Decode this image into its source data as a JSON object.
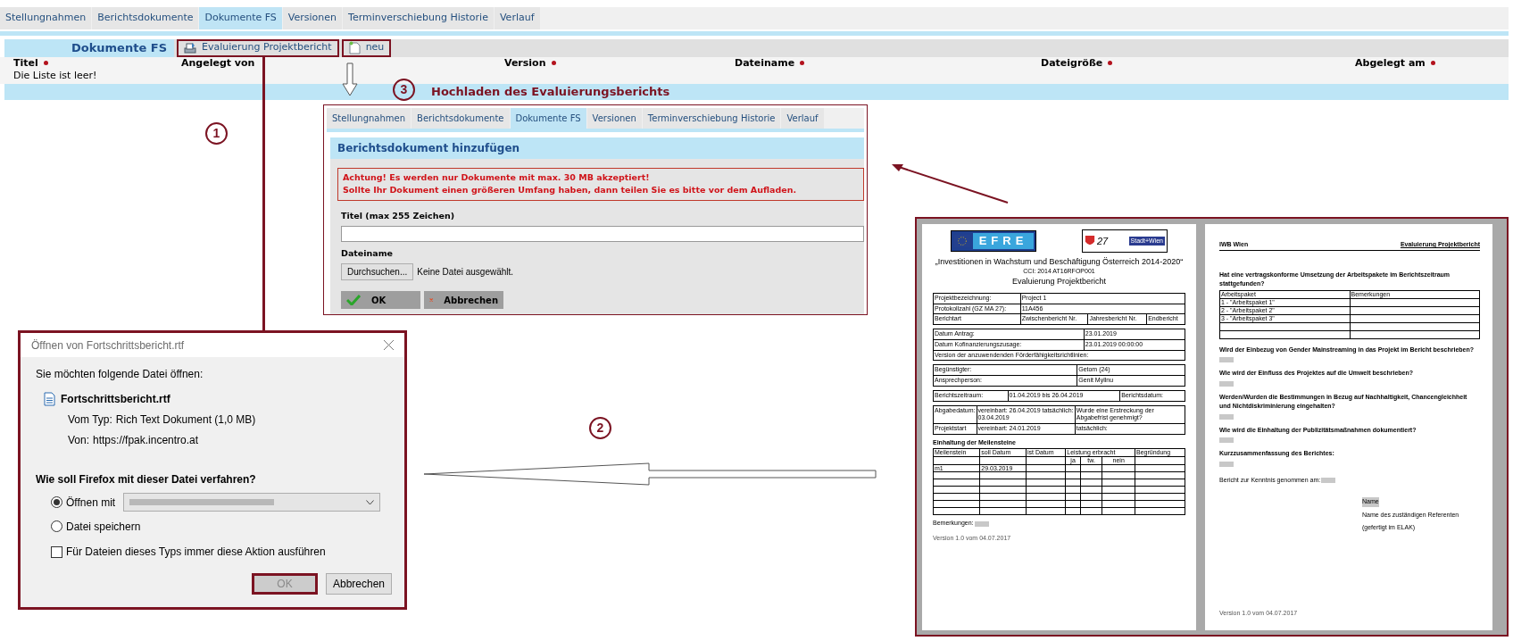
{
  "page": {
    "tabs": [
      {
        "label": "Stellungnahmen",
        "selected": false
      },
      {
        "label": "Berichtsdokumente",
        "selected": false
      },
      {
        "label": "Dokumente FS",
        "selected": true
      },
      {
        "label": "Versionen",
        "selected": false
      },
      {
        "label": "Terminverschiebung Historie",
        "selected": false
      },
      {
        "label": "Verlauf",
        "selected": false
      }
    ],
    "section_title": "Dokumente FS",
    "toolbar_buttons": [
      {
        "label": "Evaluierung Projektbericht",
        "kind": "export"
      },
      {
        "label": "neu",
        "kind": "new"
      }
    ],
    "columns": [
      {
        "label": "Titel",
        "sortable": true
      },
      {
        "label": "Angelegt von",
        "sortable": false
      },
      {
        "label": "Version",
        "sortable": true
      },
      {
        "label": "Dateiname",
        "sortable": true
      },
      {
        "label": "Dateigröße",
        "sortable": true
      },
      {
        "label": "Abgelegt am",
        "sortable": true
      }
    ],
    "empty_message": "Die Liste ist leer!"
  },
  "annotations": {
    "step_1": "1",
    "step_2": "2",
    "step_3": "3",
    "step_3_caption": "Hochladen des Evaluierungsberichts"
  },
  "upload_panel": {
    "tabs": [
      {
        "label": "Stellungnahmen",
        "selected": false
      },
      {
        "label": "Berichtsdokumente",
        "selected": false
      },
      {
        "label": "Dokumente FS",
        "selected": true
      },
      {
        "label": "Versionen",
        "selected": false
      },
      {
        "label": "Terminverschiebung Historie",
        "selected": false
      },
      {
        "label": "Verlauf",
        "selected": false
      }
    ],
    "title": "Berichtsdokument hinzufügen",
    "warning": [
      "Achtung! Es werden nur Dokumente mit max. 30 MB akzeptiert!",
      "Sollte Ihr Dokument einen größeren Umfang haben, dann teilen Sie es bitte vor dem Aufladen."
    ],
    "title_field": {
      "label": "Titel (max 255 Zeichen)"
    },
    "file_field": {
      "label": "Dateiname",
      "button": "Durchsuchen...",
      "status": "Keine Datei ausgewählt."
    },
    "buttons": [
      {
        "label": "OK",
        "kind": "ok"
      },
      {
        "label": "Abbrechen",
        "kind": "cancel"
      }
    ]
  },
  "open_dialog": {
    "title": "Öffnen von Fortschrittsbericht.rtf",
    "prompt": "Sie möchten folgende Datei öffnen:",
    "file_name": "Fortschrittsbericht.rtf",
    "details": [
      {
        "label": "Vom Typ:",
        "value": "Rich Text Dokument (1,0 MB)"
      },
      {
        "label": "Von:",
        "value": "https://fpak.incentro.at"
      }
    ],
    "question": "Wie soll Firefox mit dieser Datei verfahren?",
    "options": [
      {
        "label": "Öffnen mit",
        "selected": true,
        "kind": "select"
      },
      {
        "label": "Datei speichern",
        "selected": false,
        "kind": "plain"
      }
    ],
    "remember": {
      "label": "Für Dateien dieses Typs immer diese Aktion ausführen",
      "checked": false
    },
    "buttons": [
      {
        "label": "OK",
        "disabled": true
      },
      {
        "label": "Abbrechen",
        "disabled": false
      }
    ]
  },
  "document_preview": {
    "page_1": {
      "logo_left": "EFRE",
      "logo_right_number": "27",
      "logo_right_band": "Stadt+Wien",
      "heading": "„Investitionen in Wachstum und Beschäftigung Österreich 2014-2020“",
      "cci": "CCI: 2014 AT16RFOP001",
      "title": "Evaluierung Projektbericht",
      "tables": [
        [
          [
            "Projektbezeichnung:",
            "Project 1"
          ],
          [
            "Protokollzahl (GZ MA 27):",
            "11A456"
          ],
          [
            "Berichtart",
            "Zwischenbericht Nr.",
            "Jahresbericht Nr.",
            "Endbericht"
          ]
        ],
        [
          [
            "Datum Antrag:",
            "23.01.2019"
          ],
          [
            "Datum Kofinanzierungszusage:",
            "23.01.2019 00:00:00"
          ],
          [
            "Version der anzuwendenden Förderfähigkeitsrichtlinien:"
          ]
        ],
        [
          [
            "Begünstigter:",
            "Getom (24)"
          ],
          [
            "Ansprechperson:",
            "Genit Myllnu"
          ]
        ],
        [
          [
            "Berichtszeitraum:",
            "01.04.2019 bis 26.04.2019",
            "Berichtsdatum:"
          ]
        ],
        [
          [
            "Abgabedatum:",
            "vereinbart: 26.04.2019 tatsächlich: 03.04.2019",
            "Wurde eine Erstreckung der Abgabefrist genehmigt?"
          ],
          [
            "Projektstart",
            "vereinbart: 24.01.2019",
            "tatsächlich:"
          ]
        ]
      ],
      "milestones": {
        "heading": "Einhaltung der Meilensteine",
        "columns": [
          "Meilenstein",
          "soll Datum",
          "ist Datum",
          "Leistung erbracht",
          "Begründung"
        ],
        "subcolumns": [
          "ja",
          "tw.",
          "nein"
        ],
        "rows": [
          [
            "m1",
            "29.03.2019"
          ]
        ]
      },
      "remarks_label": "Bemerkungen:",
      "footer": "Version 1.0 vom 04.07.2017"
    },
    "page_2": {
      "header_left": "IWB Wien",
      "header_right": "Evaluierung Projektbericht",
      "work_question": "Hat eine vertragskonforme Umsetzung der Arbeitspakete im Berichtszeitraum stattgefunden?",
      "work_table": [
        [
          "Arbeitspaket",
          "Bemerkungen"
        ],
        [
          "1 - \"Arbeitspaket 1\""
        ],
        [
          "2 - \"Arbeitspaket 2\""
        ],
        [
          "3 - \"Arbeitspaket 3\""
        ]
      ],
      "questions": [
        "Wird der Einbezug von Gender Mainstreaming in das Projekt im Bericht beschrieben?",
        "Wie wird der Einfluss des Projektes auf die Umwelt beschrieben?",
        "Werden/Wurden die Bestimmungen in Bezug auf Nachhaltigkeit, Chancengleichheit und Nichtdiskriminierung eingehalten?",
        "Wie wird die Einhaltung der Publizitätsmaßnahmen dokumentiert?",
        "Kurzzusammenfassung des Berichtes:"
      ],
      "acknowledged": "Bericht zur Kenntnis genommen am:",
      "signature": [
        "Name",
        "Name des zuständigen Referenten",
        "(gefertigt im ELAK)"
      ],
      "footer": "Version 1.0 vom 04.07.2017"
    }
  }
}
